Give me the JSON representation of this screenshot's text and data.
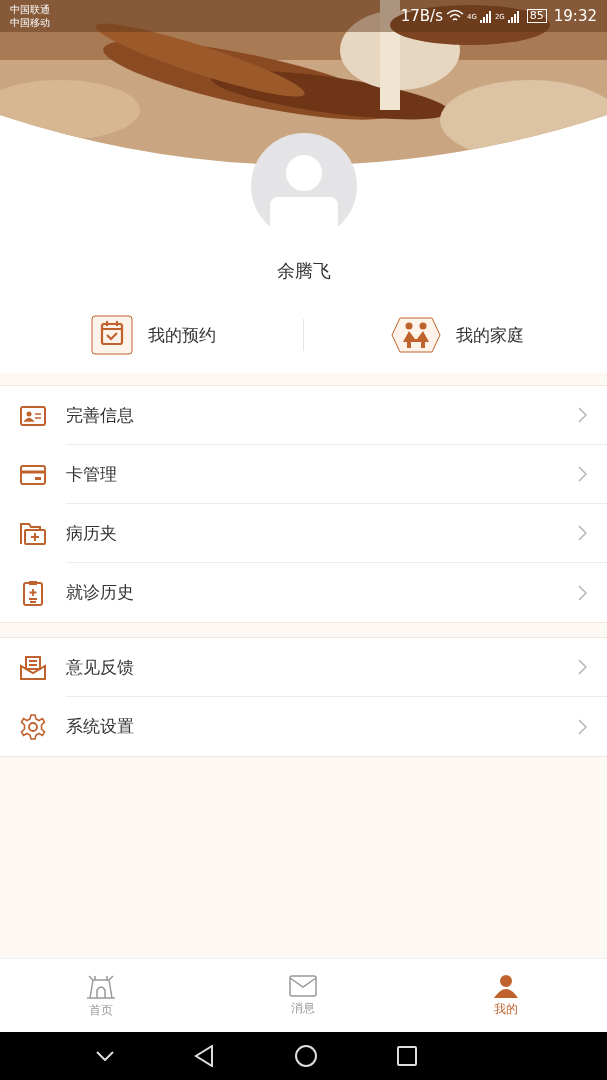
{
  "status_bar": {
    "carriers": [
      "中国联通",
      "中国移动"
    ],
    "speed": "17B/s",
    "network_1": "4G",
    "network_2": "2G",
    "battery": "85",
    "time": "19:32"
  },
  "profile": {
    "name": "余腾飞"
  },
  "quick_links": [
    {
      "kind": "appointment",
      "label": "我的预约"
    },
    {
      "kind": "family",
      "label": "我的家庭"
    }
  ],
  "menu_groups": [
    [
      {
        "kind": "id-card",
        "label": "完善信息"
      },
      {
        "kind": "card",
        "label": "卡管理"
      },
      {
        "kind": "folder",
        "label": "病历夹"
      },
      {
        "kind": "clipboard",
        "label": "就诊历史"
      }
    ],
    [
      {
        "kind": "feedback",
        "label": "意见反馈"
      },
      {
        "kind": "settings",
        "label": "系统设置"
      }
    ]
  ],
  "tabs": [
    {
      "kind": "home",
      "label": "首页",
      "selected": false
    },
    {
      "kind": "messages",
      "label": "消息",
      "selected": false
    },
    {
      "kind": "me",
      "label": "我的",
      "selected": true
    }
  ]
}
